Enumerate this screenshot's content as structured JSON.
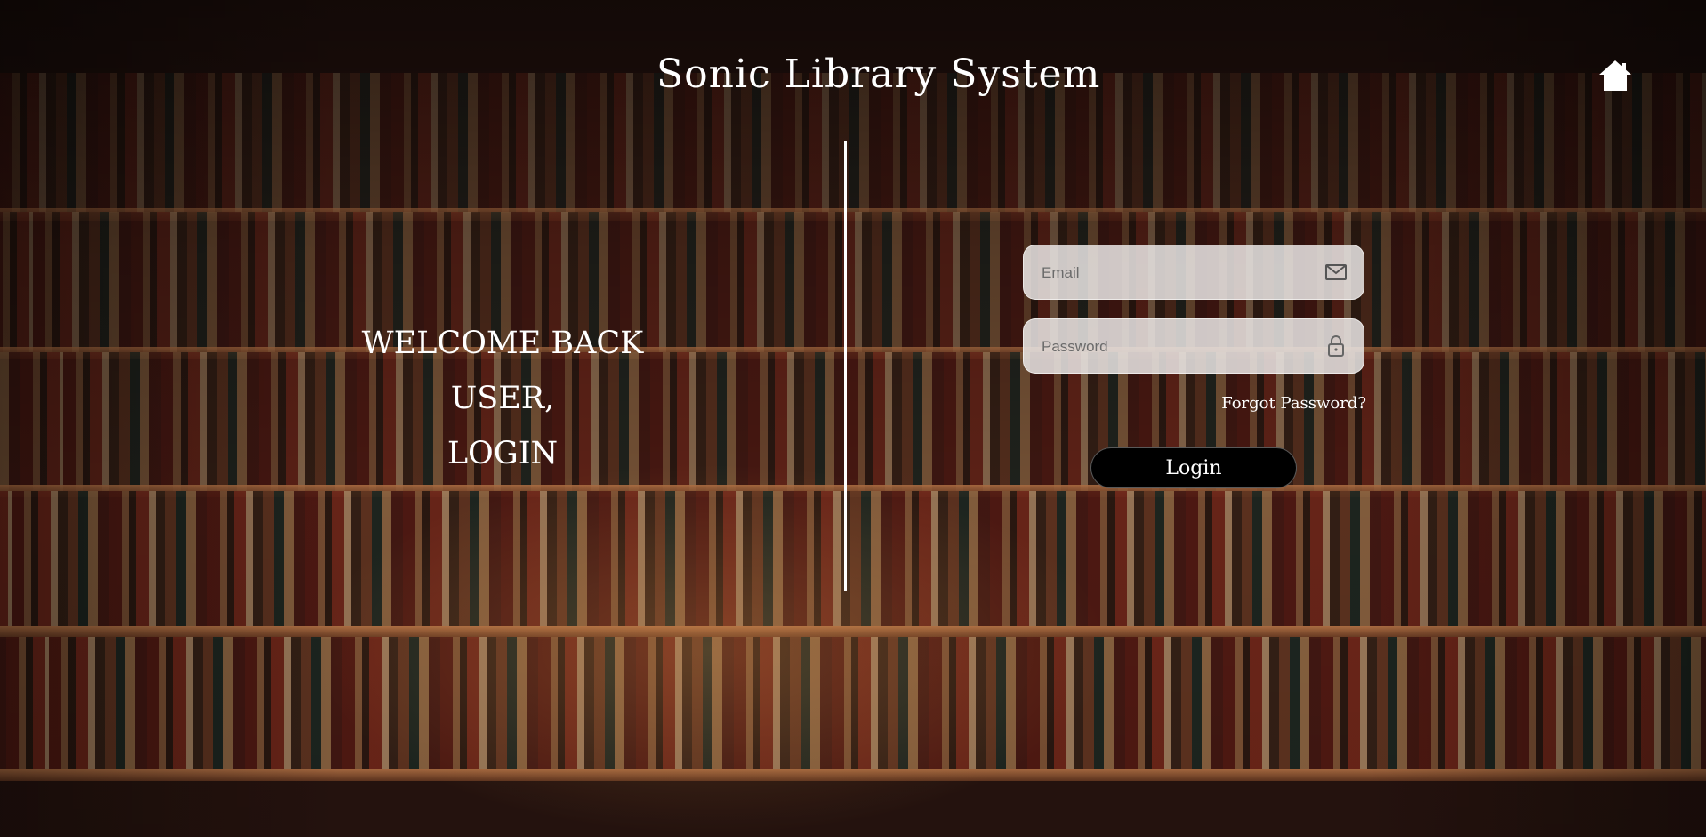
{
  "header": {
    "title": "Sonic Library System",
    "home_icon": "home-icon"
  },
  "welcome": {
    "line1": "WELCOME BACK USER,",
    "line2": "LOGIN"
  },
  "form": {
    "email_placeholder": "Email",
    "email_value": "",
    "email_icon": "envelope-icon",
    "password_placeholder": "Password",
    "password_value": "",
    "password_icon": "lock-icon",
    "forgot_label": "Forgot Password?",
    "login_label": "Login"
  },
  "colors": {
    "text": "#ffffff",
    "button_bg": "#000000",
    "field_bg": "#ebe8e6"
  }
}
